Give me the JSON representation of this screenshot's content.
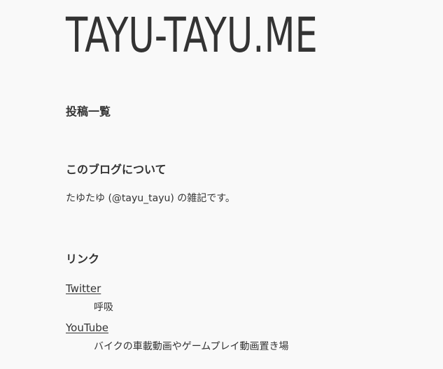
{
  "site": {
    "title": "TAYU-TAYU.ME"
  },
  "posts_section": {
    "heading": "投稿一覧"
  },
  "about_section": {
    "heading": "このブログについて",
    "description": "たゆたゆ (@tayu_tayu) の雑記です。"
  },
  "links_section": {
    "heading": "リンク",
    "items": [
      {
        "label": "Twitter",
        "description": "呼吸"
      },
      {
        "label": "YouTube",
        "description": "バイクの車載動画やゲームプレイ動画置き場"
      }
    ]
  }
}
